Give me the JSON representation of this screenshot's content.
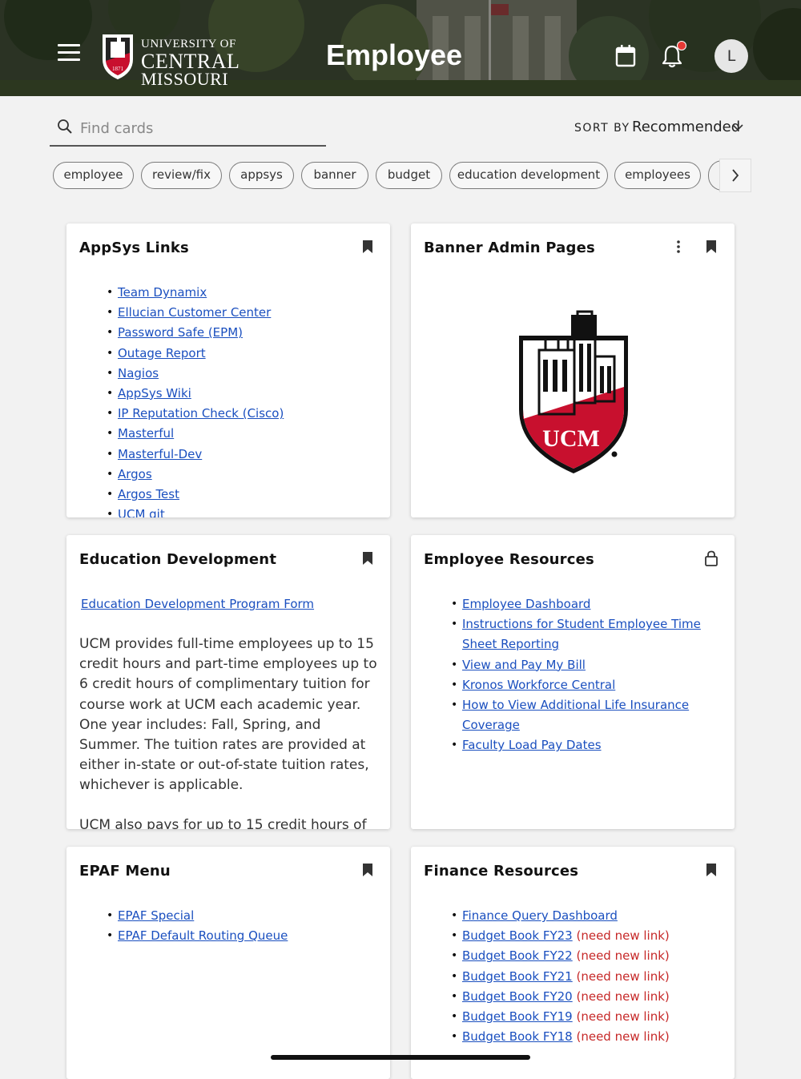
{
  "header": {
    "title": "Employee",
    "logo": {
      "line1": "UNIVERSITY OF",
      "line2": "CENTRAL",
      "line3": "MISSOURI",
      "year": "1871"
    },
    "avatar_initial": "L"
  },
  "search": {
    "placeholder": "Find cards",
    "value": ""
  },
  "sort": {
    "label": "SORT BY",
    "value": "Recommended"
  },
  "chips": [
    "employee",
    "review/fix",
    "appsys",
    "banner",
    "budget",
    "education development",
    "employees"
  ],
  "cards": {
    "appsys": {
      "title": "AppSys Links",
      "links": [
        "Team Dynamix",
        "Ellucian Customer Center",
        "Password Safe (EPM)",
        "Outage Report",
        "Nagios",
        "AppSys Wiki",
        "IP Reputation Check (Cisco)",
        "Masterful",
        "Masterful-Dev",
        "Argos",
        "Argos Test",
        "UCM git"
      ]
    },
    "banner": {
      "title": "Banner Admin Pages",
      "image_text": "UCM"
    },
    "education": {
      "title": "Education Development",
      "link": "Education Development Program Form",
      "paragraph": "UCM provides full-time employees up to 15 credit hours and part-time employees up to 6 credit hours of complimentary tuition for course work at UCM each academic year. One year includes: Fall, Spring, and Summer. The tuition rates are provided at either in-state or out-of-state tuition rates, whichever is applicable.",
      "paragraph2": "UCM also pays for up to 15 credit hours of"
    },
    "employee_resources": {
      "title": "Employee Resources",
      "links": [
        "Employee Dashboard",
        "Instructions for Student Employee Time Sheet Reporting",
        "View and Pay My Bill",
        "Kronos Workforce Central",
        "How to View Additional Life Insurance Coverage",
        "Faculty Load Pay Dates"
      ]
    },
    "epaf": {
      "title": "EPAF Menu",
      "links": [
        "EPAF Special",
        "EPAF Default Routing Queue"
      ]
    },
    "finance": {
      "title": "Finance Resources",
      "first_link": "Finance Query Dashboard",
      "budget_links": [
        "Budget Book FY23",
        "Budget Book FY22",
        "Budget Book FY21",
        "Budget Book FY20",
        "Budget Book FY19",
        "Budget Book FY18"
      ],
      "note": "(need new link)"
    }
  },
  "colors": {
    "link": "#1a4fbf",
    "warning": "#c62828",
    "brand_red": "#c8102e"
  }
}
